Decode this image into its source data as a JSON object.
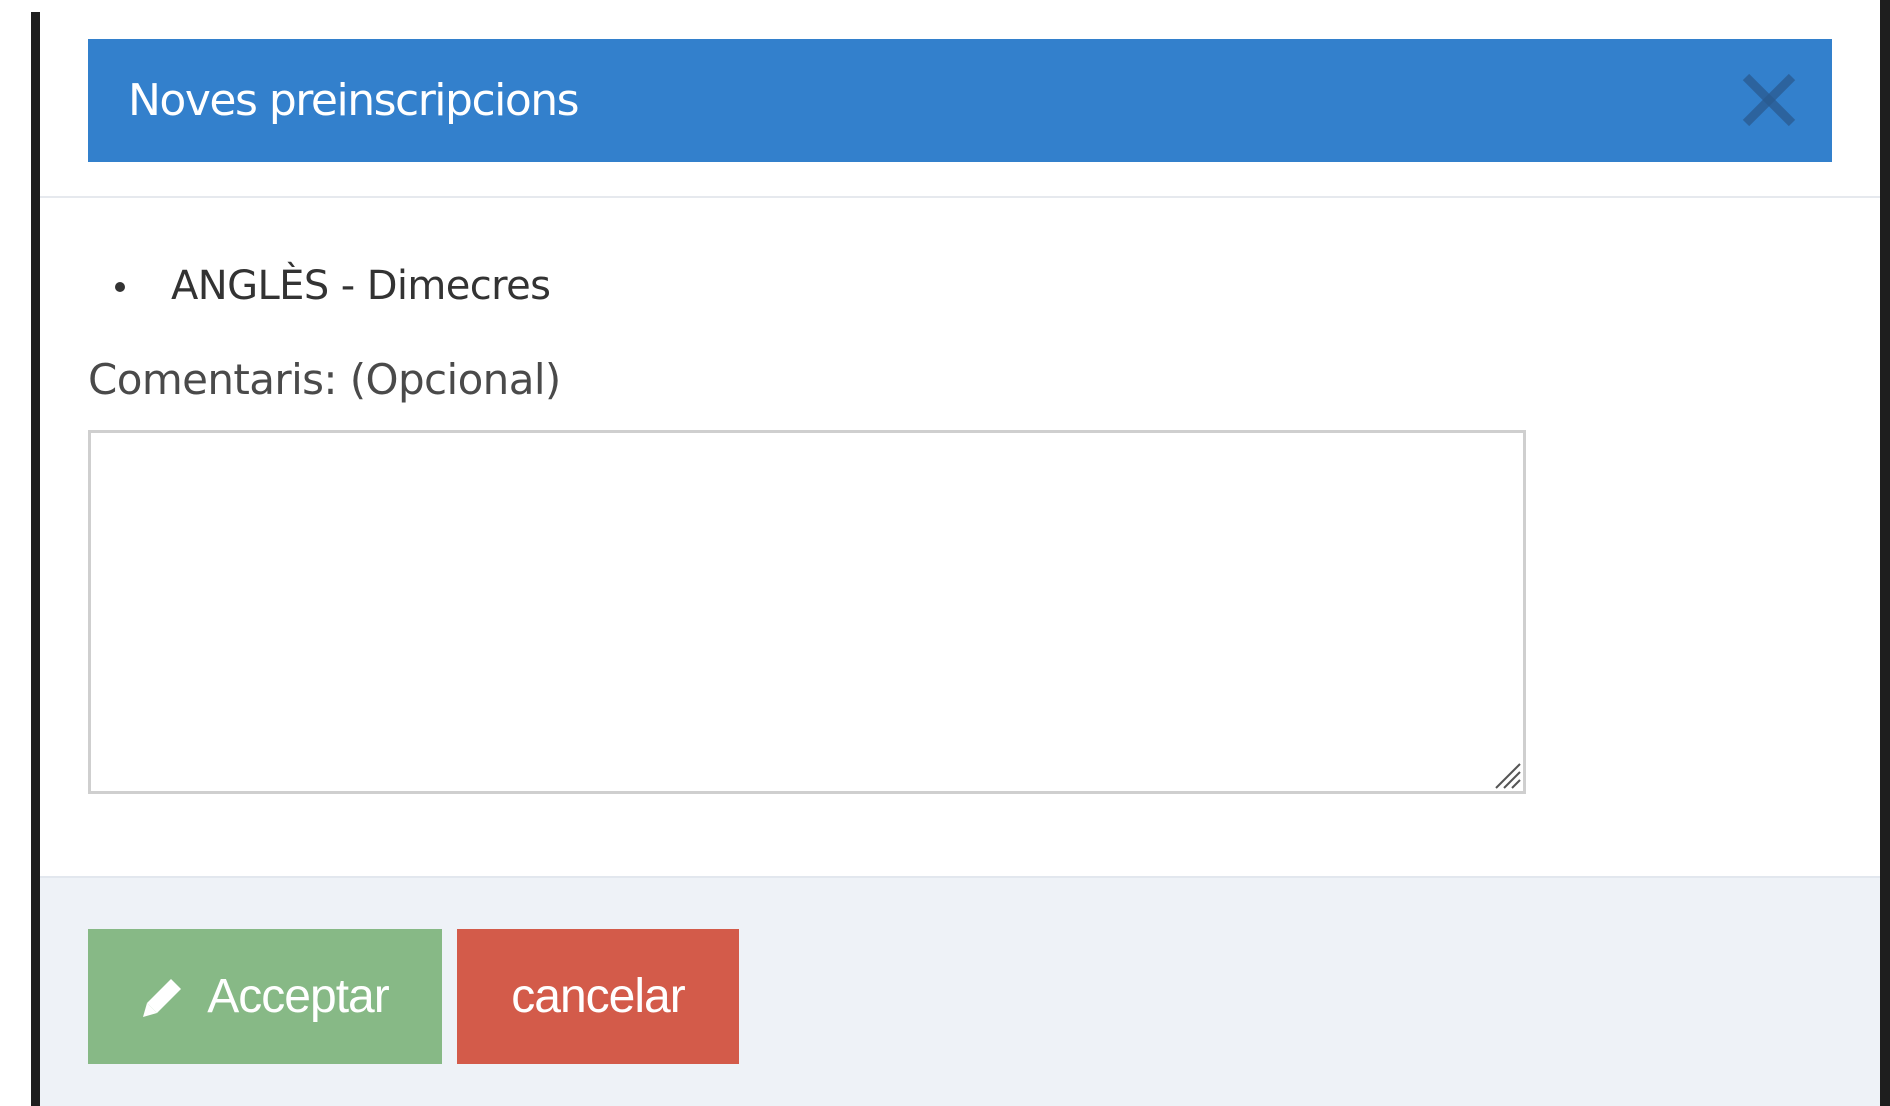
{
  "modal": {
    "title": "Noves preinscripcions",
    "header_color": "#3380cc",
    "close_icon": "close-icon"
  },
  "courses": [
    {
      "label": "ANGLÈS - Dimecres"
    }
  ],
  "comments": {
    "label": "Comentaris: (Opcional)",
    "value": "",
    "placeholder": ""
  },
  "footer": {
    "accept_label": "Acceptar",
    "accept_icon": "pencil-icon",
    "accept_color": "#87b986",
    "cancel_label": "cancelar",
    "cancel_color": "#d35b4a"
  }
}
